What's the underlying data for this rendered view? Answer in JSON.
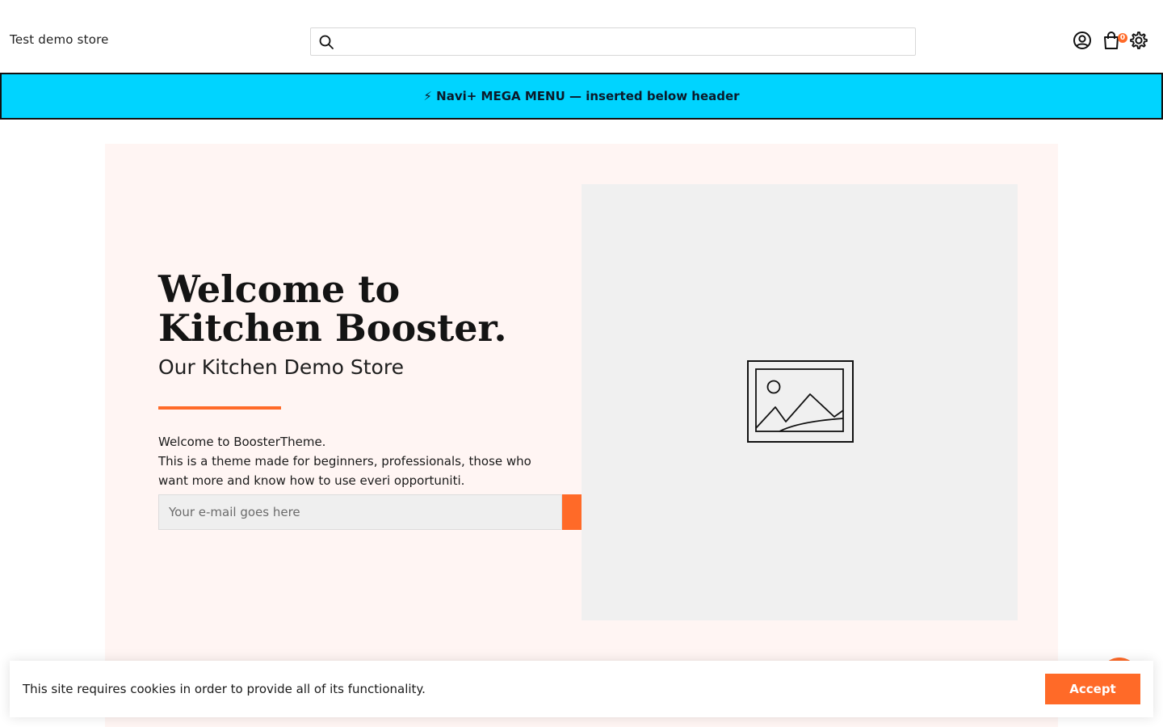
{
  "header": {
    "store_name": "Test demo store",
    "search_value": "",
    "search_placeholder": "",
    "search_icon": "search-icon",
    "account_icon": "account-icon",
    "cart_icon": "cart-icon",
    "cart_count": "0",
    "settings_icon": "gear-icon"
  },
  "mega_menu": {
    "text": "⚡ Navi+ MEGA MENU — inserted below header",
    "background": "#00d4ff"
  },
  "hero": {
    "title": "Welcome to Kitchen Booster.",
    "subtitle": "Our Kitchen Demo Store",
    "description_lines": [
      "Welcome to BoosterTheme.",
      "This is a theme made for beginners, professionals, those who",
      "want more and know how to use everi opportuniti."
    ],
    "email_placeholder": "Your e-mail goes here",
    "image_icon": "image-placeholder-icon",
    "background": "#fff5f3"
  },
  "cookie_banner": {
    "text": "This site requires cookies in order to provide all of its functionality.",
    "accept_label": "Accept"
  },
  "colors": {
    "accent": "#ff6a28",
    "mega_menu": "#00d4ff",
    "hero_bg": "#fff5f3",
    "image_bg": "#f0f0f0"
  }
}
